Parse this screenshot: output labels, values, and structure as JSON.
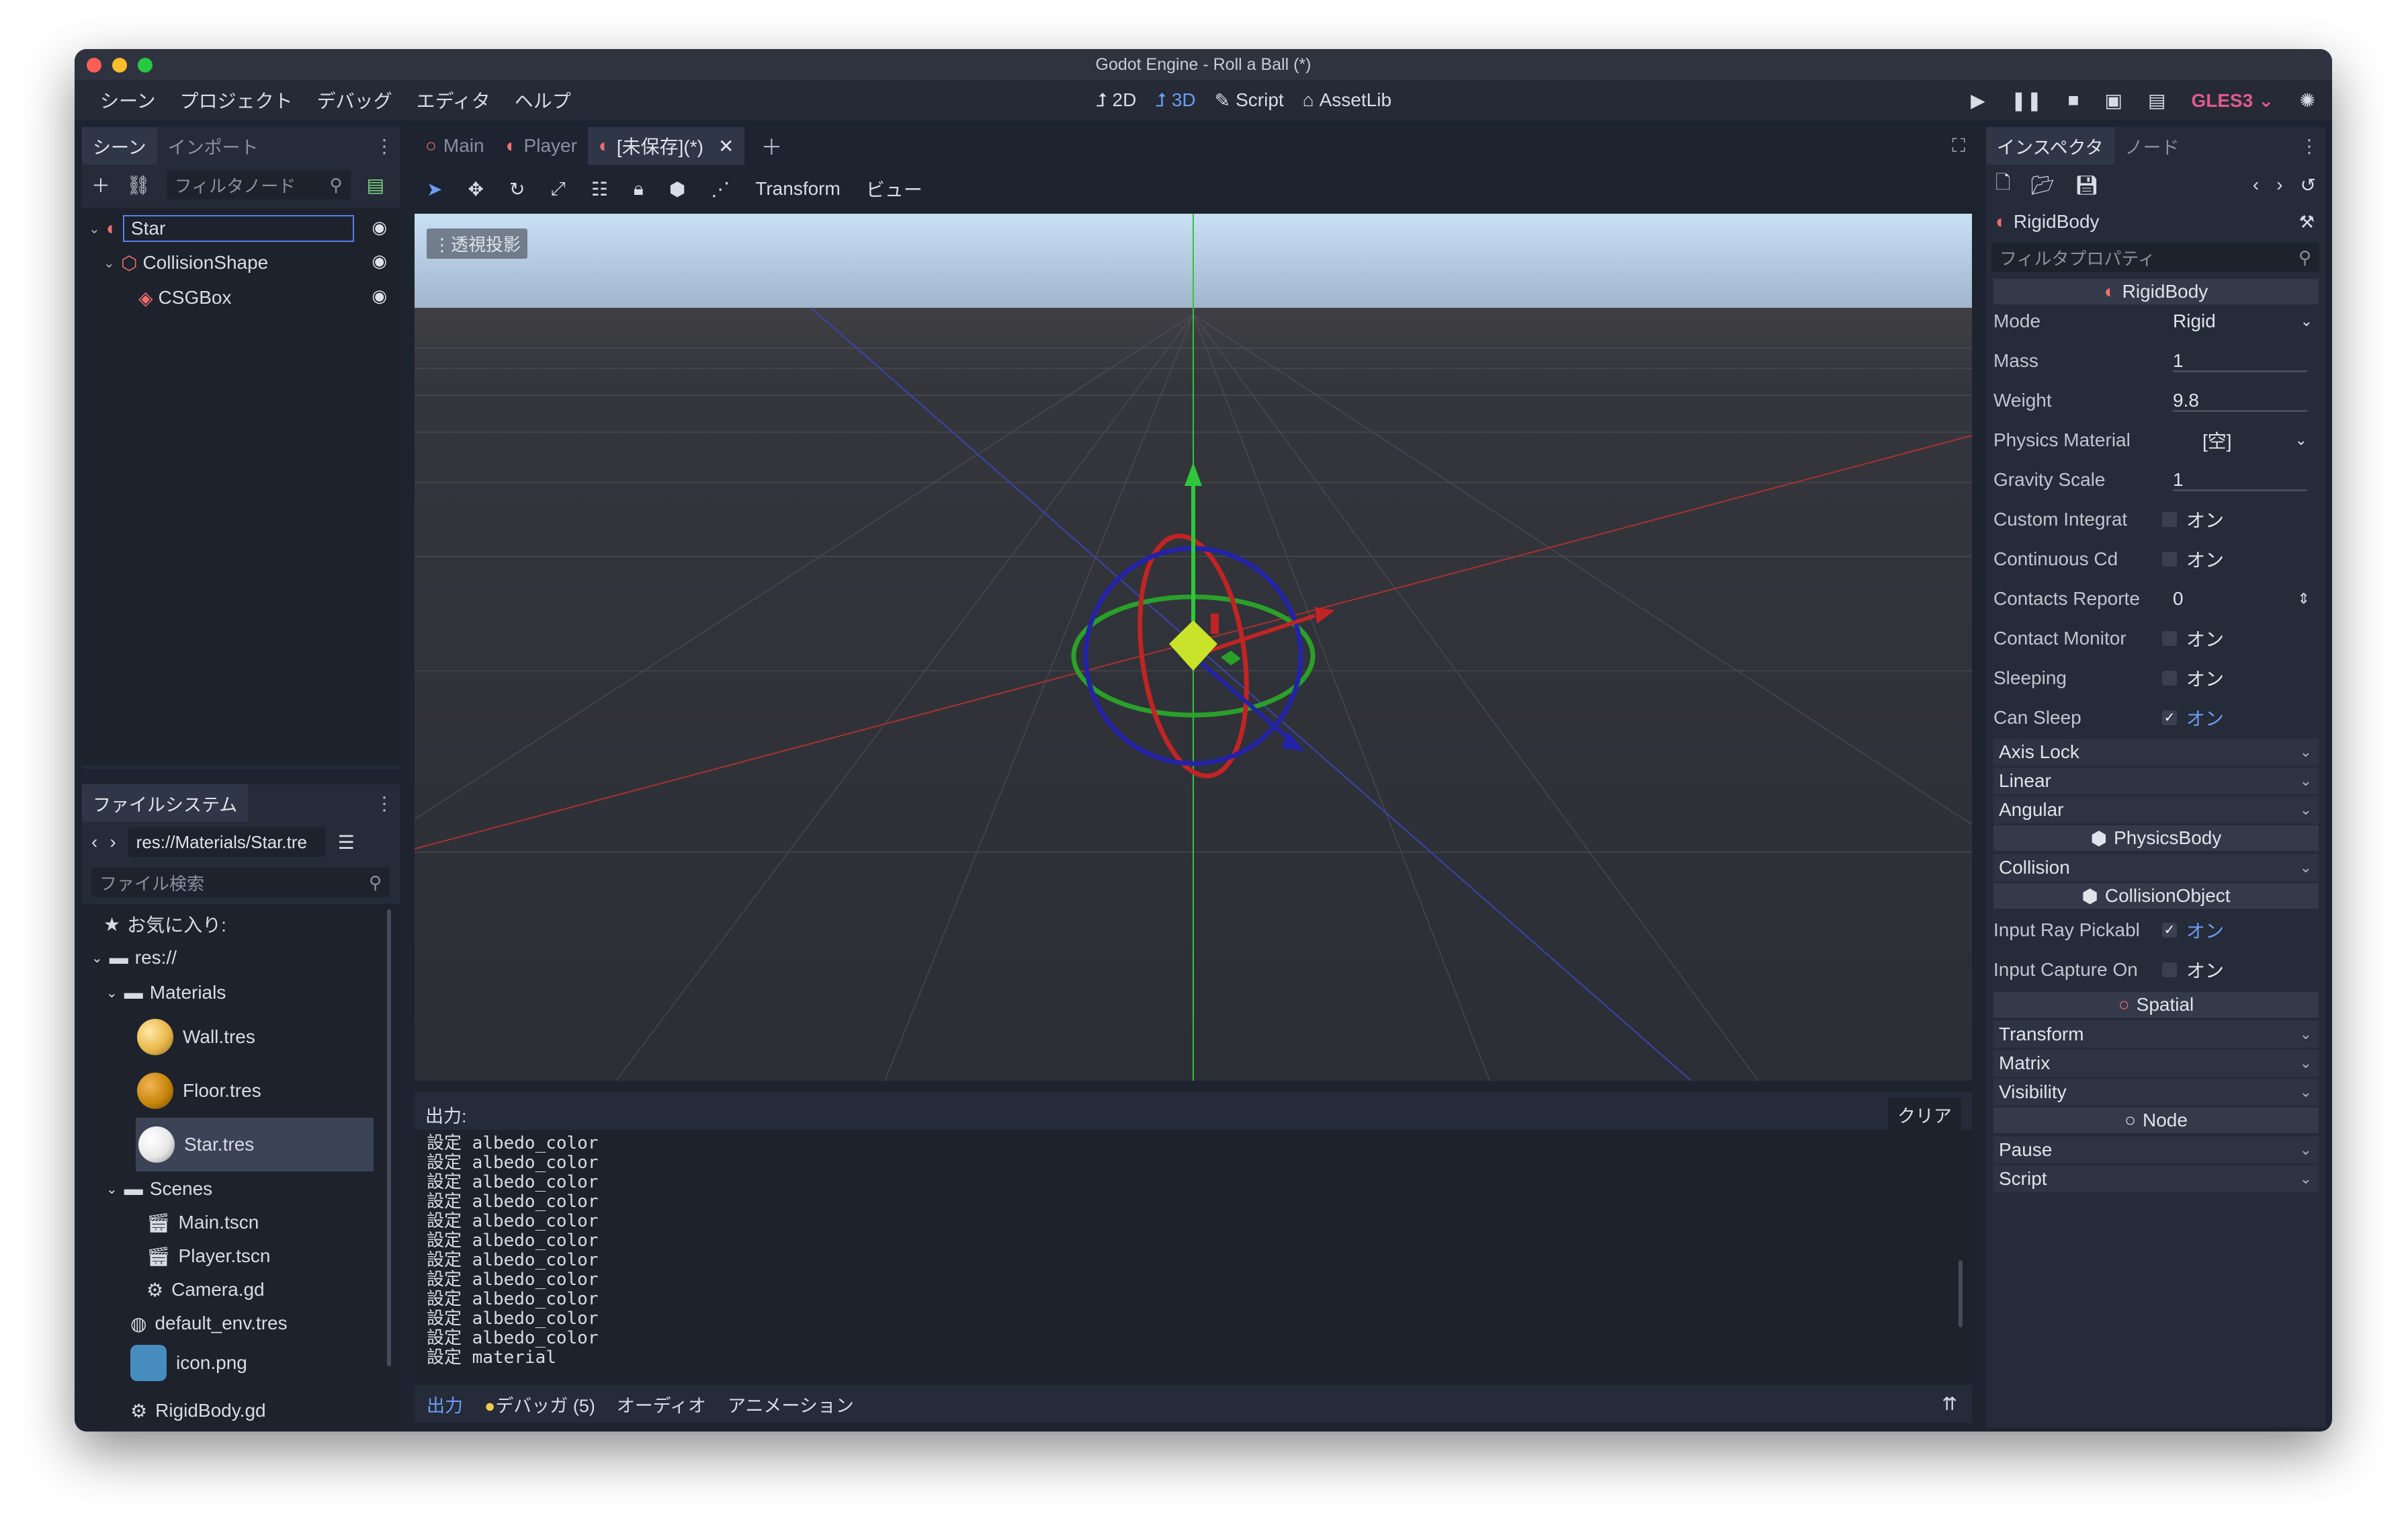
{
  "window": {
    "title": "Godot Engine - Roll a Ball (*)"
  },
  "menu": [
    "シーン",
    "プロジェクト",
    "デバッグ",
    "エディタ",
    "ヘルプ"
  ],
  "modes": {
    "m2d": "2D",
    "m3d": "3D",
    "script": "Script",
    "assetlib": "AssetLib"
  },
  "renderer": "GLES3",
  "scene_dock": {
    "tabs": [
      "シーン",
      "インポート"
    ],
    "filter_placeholder": "フィルタノード",
    "tree": [
      {
        "label": "Star",
        "level": 0
      },
      {
        "label": "CollisionShape",
        "level": 1
      },
      {
        "label": "CSGBox",
        "level": 2
      }
    ]
  },
  "filesystem": {
    "tab": "ファイルシステム",
    "path": "res://Materials/Star.tre",
    "search_placeholder": "ファイル検索",
    "favorites": "お気に入り:",
    "root": "res://",
    "materials_folder": "Materials",
    "materials": [
      {
        "name": "Wall.tres",
        "color": "#e8b84a"
      },
      {
        "name": "Floor.tres",
        "color": "#c8860c"
      },
      {
        "name": "Star.tres",
        "color": "#f0f0f0"
      }
    ],
    "scenes_folder": "Scenes",
    "scenes": [
      "Main.tscn",
      "Player.tscn",
      "Camera.gd"
    ],
    "env": "default_env.tres",
    "icon": "icon.png",
    "cut_item": "RigidBody.gd"
  },
  "editor_tabs": [
    {
      "label": "Main"
    },
    {
      "label": "Player"
    },
    {
      "label": "[未保存](*)"
    }
  ],
  "viewport": {
    "toolbar_transform": "Transform",
    "toolbar_view": "ビュー",
    "perspective_label": "透視投影"
  },
  "output": {
    "title": "出力:",
    "clear": "クリア",
    "lines": [
      "設定 albedo_color",
      "設定 albedo_color",
      "設定 albedo_color",
      "設定 albedo_color",
      "設定 albedo_color",
      "設定 albedo_color",
      "設定 albedo_color",
      "設定 albedo_color",
      "設定 albedo_color",
      "設定 albedo_color",
      "設定 albedo_color",
      "設定 material"
    ],
    "tabs": {
      "output": "出力",
      "debugger": "デバッガ (5)",
      "audio": "オーディオ",
      "animation": "アニメーション"
    }
  },
  "inspector": {
    "tabs": [
      "インスペクタ",
      "ノード"
    ],
    "object": "RigidBody",
    "filter_placeholder": "フィルタプロパティ",
    "rigidbody_section": "RigidBody",
    "mode": {
      "label": "Mode",
      "value": "Rigid"
    },
    "mass": {
      "label": "Mass",
      "value": "1"
    },
    "weight": {
      "label": "Weight",
      "value": "9.8"
    },
    "physics_material": {
      "label": "Physics Material",
      "value": "[空]"
    },
    "gravity_scale": {
      "label": "Gravity Scale",
      "value": "1"
    },
    "custom_integrator": {
      "label": "Custom Integrat",
      "value": "オン"
    },
    "continuous_cd": {
      "label": "Continuous Cd",
      "value": "オン"
    },
    "contacts_reported": {
      "label": "Contacts Reporte",
      "value": "0"
    },
    "contact_monitor": {
      "label": "Contact Monitor",
      "value": "オン"
    },
    "sleeping": {
      "label": "Sleeping",
      "value": "オン"
    },
    "can_sleep": {
      "label": "Can Sleep",
      "value": "オン"
    },
    "axis_lock": "Axis Lock",
    "linear": "Linear",
    "angular": "Angular",
    "physicsbody_section": "PhysicsBody",
    "collision": "Collision",
    "collisionobject_section": "CollisionObject",
    "input_ray": {
      "label": "Input Ray Pickabl",
      "value": "オン"
    },
    "input_capture": {
      "label": "Input Capture On",
      "value": "オン"
    },
    "spatial_section": "Spatial",
    "transform": "Transform",
    "matrix": "Matrix",
    "visibility": "Visibility",
    "node_section": "Node",
    "pause": "Pause",
    "script": "Script"
  }
}
